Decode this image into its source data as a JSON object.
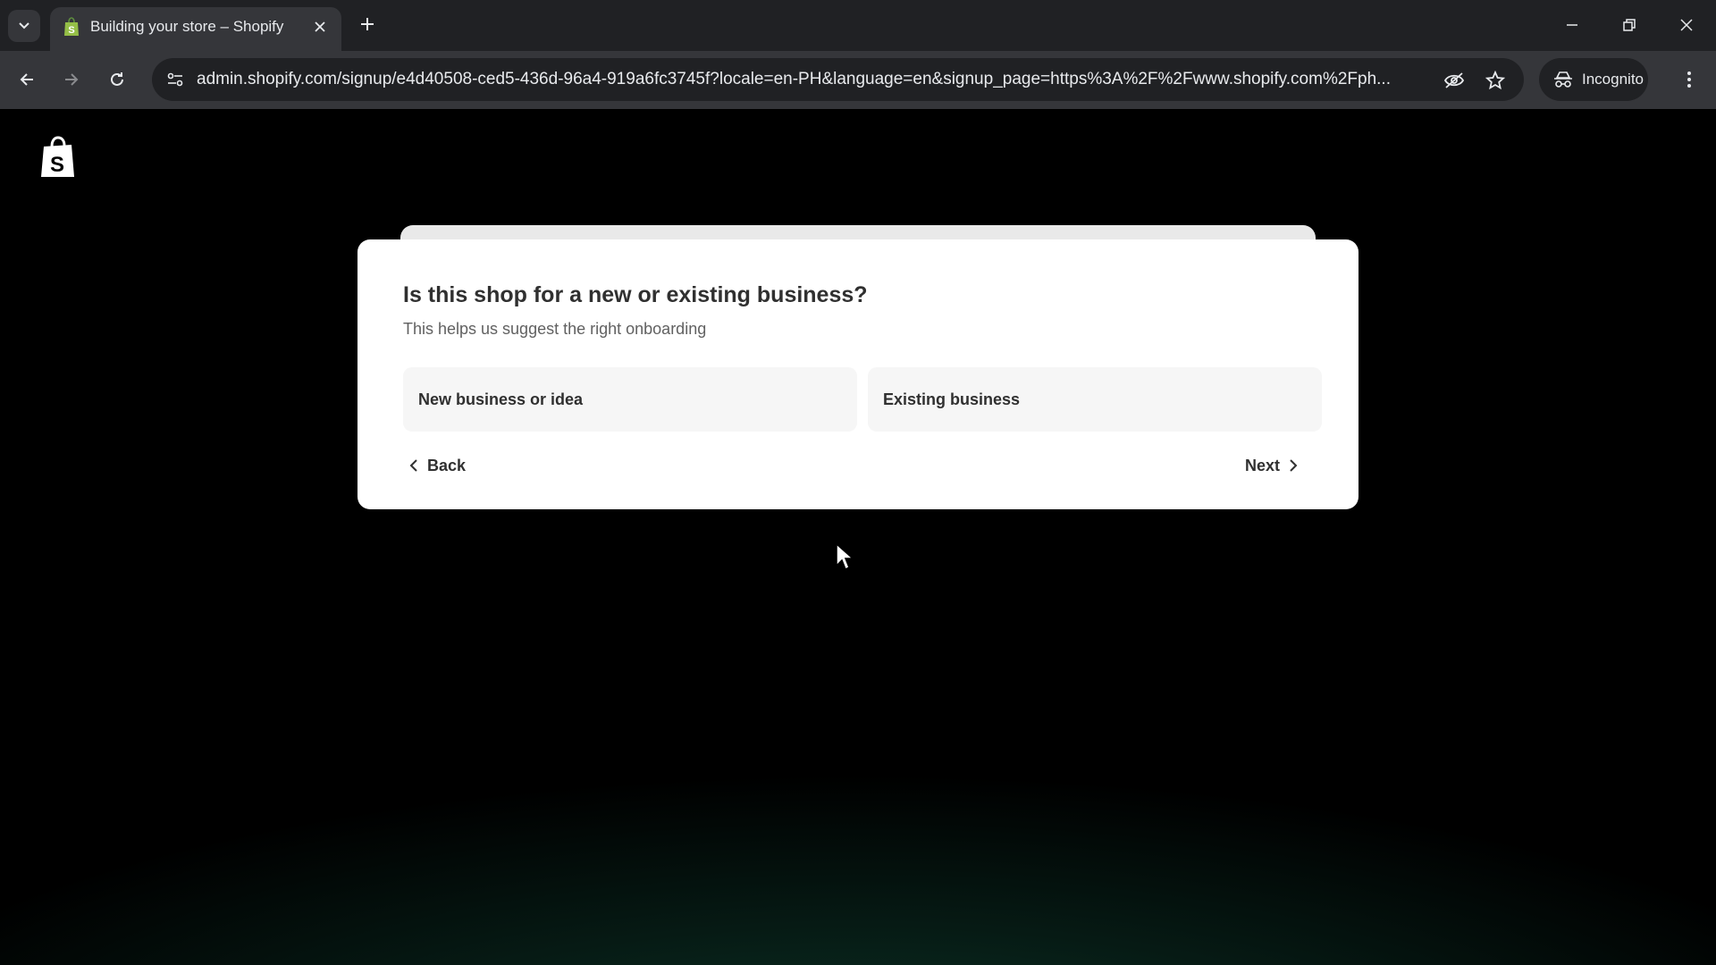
{
  "browser": {
    "tab": {
      "title": "Building your store – Shopify",
      "favicon": "shopify-bag-icon"
    },
    "address_bar": {
      "url": "admin.shopify.com/signup/e4d40508-ced5-436d-96a4-919a6fc3745f?locale=en-PH&language=en&signup_page=https%3A%2F%2Fwww.shopify.com%2Fph..."
    },
    "incognito_label": "Incognito"
  },
  "page": {
    "logo": "shopify-bag-icon",
    "question": {
      "title": "Is this shop for a new or existing business?",
      "subtitle": "This helps us suggest the right onboarding",
      "options": [
        {
          "label": "New business or idea"
        },
        {
          "label": "Existing business"
        }
      ]
    },
    "back_label": "Back",
    "next_label": "Next"
  },
  "colors": {
    "accent_green": "#0d3a2b",
    "card_bg": "#ffffff",
    "option_bg": "#f6f6f6",
    "text_dark": "#303030"
  }
}
